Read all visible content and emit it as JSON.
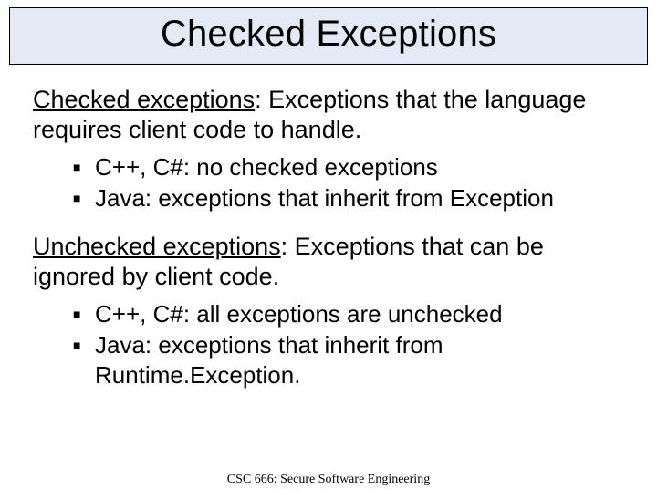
{
  "title": "Checked Exceptions",
  "section1": {
    "label": "Checked exceptions",
    "definition": ": Exceptions that the language requires client code to handle.",
    "bullets": [
      "C++, C#: no checked exceptions",
      "Java: exceptions that inherit from Exception"
    ]
  },
  "section2": {
    "label": "Unchecked exceptions",
    "definition": ": Exceptions that can be ignored by client code.",
    "bullets": [
      "C++, C#: all exceptions are unchecked",
      "Java: exceptions that inherit from Runtime.Exception."
    ]
  },
  "footer": "CSC 666: Secure Software Engineering"
}
